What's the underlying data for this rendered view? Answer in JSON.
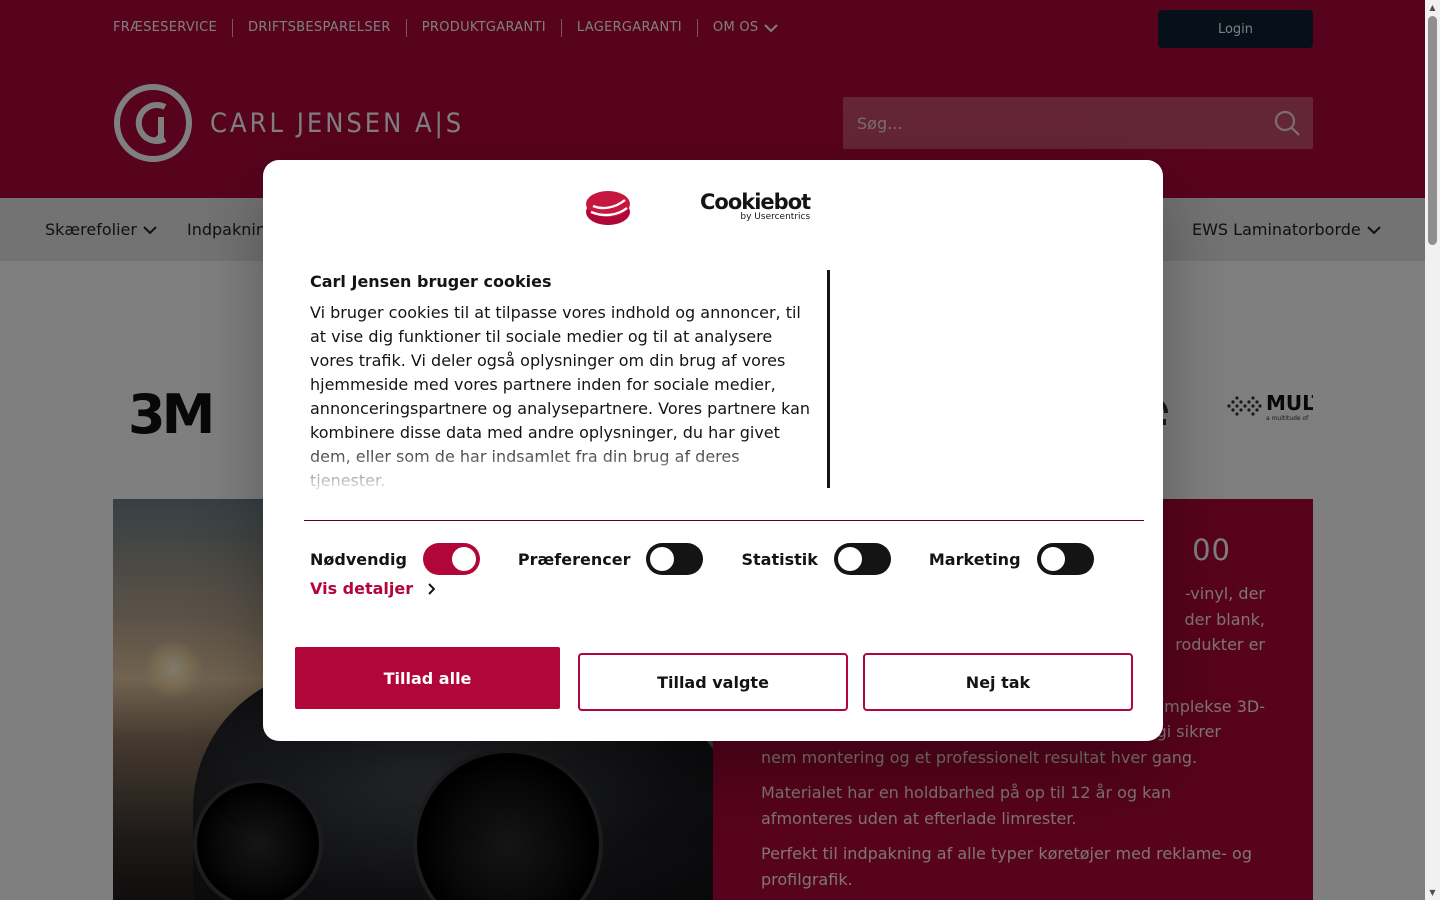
{
  "header": {
    "top_links": [
      {
        "label": "FRÆSESERVICE"
      },
      {
        "label": "DRIFTSBESPARELSER"
      },
      {
        "label": "PRODUKTGARANTI"
      },
      {
        "label": "LAGERGARANTI"
      },
      {
        "label": "OM OS"
      }
    ],
    "login_label": "Login",
    "logo_text": "CARL JENSEN A|S",
    "search_placeholder": "Søg..."
  },
  "categories": [
    {
      "label": "Skærefolier"
    },
    {
      "label": "Indpakning"
    },
    {
      "label": "EWS Laminatorborde"
    }
  ],
  "brands": {
    "first": "3M",
    "last": "MULTI",
    "last_sub": "a multitude of"
  },
  "hero": {
    "title": "00",
    "paragraphs": [
      "-vinyl, der",
      "der blank,",
      "rodukter er",
      "mplekse 3D-",
      "ogi sikrer",
      "nem montering og et professionelt resultat hver gang.",
      "Materialet har en holdbarhed på op til 12 år og kan afmonteres uden at efterlade limrester.",
      "Perfekt til indpakning af alle typer køretøjer med reklame- og profilgrafik."
    ]
  },
  "cookie_dialog": {
    "brand_name": "Cookiebot",
    "brand_sub": "by Usercentrics",
    "heading": "Carl Jensen bruger cookies",
    "body": "Vi bruger cookies til at tilpasse vores indhold og annoncer, til at vise dig funktioner til sociale medier og til at analysere vores trafik. Vi deler også oplysninger om din brug af vores hjemmeside med vores partnere inden for sociale medier, annonceringspartnere og analysepartnere. Vores partnere kan kombinere disse data med andre oplysninger, du har givet dem, eller som de har indsamlet fra din brug af deres tjenester.",
    "toggles": [
      {
        "label": "Nødvendig",
        "checked": true
      },
      {
        "label": "Præferencer",
        "checked": false
      },
      {
        "label": "Statistik",
        "checked": false
      },
      {
        "label": "Marketing",
        "checked": false
      }
    ],
    "details_label": "Vis detaljer",
    "buttons": {
      "allow_all": "Tillad alle",
      "allow_selected": "Tillad valgte",
      "deny": "Nej tak"
    }
  },
  "colors": {
    "brand": "#b1063a",
    "login_bg": "#0f1e33",
    "overlay": "rgba(0,0,0,0.5)"
  }
}
